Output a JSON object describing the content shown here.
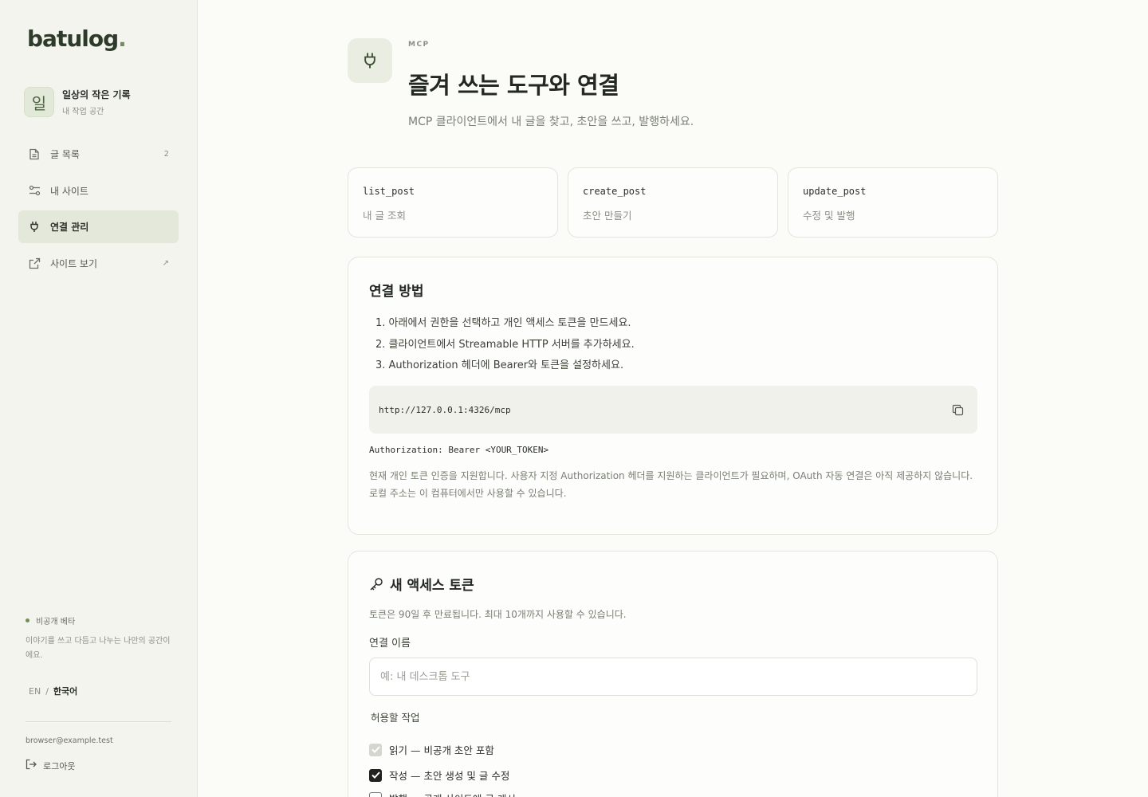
{
  "brand": {
    "name": "batulog",
    "dot": "."
  },
  "workspace": {
    "avatar": "일",
    "name": "일상의 작은 기록",
    "subtitle": "내 작업 공간"
  },
  "nav": [
    {
      "label": "글 목록",
      "icon": "document-icon",
      "trailing": "2"
    },
    {
      "label": "내 사이트",
      "icon": "sliders-icon",
      "trailing": ""
    },
    {
      "label": "연결 관리",
      "icon": "plug-icon",
      "trailing": "",
      "active": true
    },
    {
      "label": "사이트 보기",
      "icon": "external-link-icon",
      "trailing": "↗"
    }
  ],
  "beta": {
    "badge": "비공개 베타",
    "description": "이야기를 쓰고 다듬고 나누는 나만의 공간이에요."
  },
  "language": {
    "en": "EN",
    "separator": "/",
    "current": "한국어"
  },
  "account": {
    "email": "browser@example.test",
    "logout_label": "로그아웃"
  },
  "header": {
    "eyebrow": "MCP",
    "title": "즐겨 쓰는 도구와 연결",
    "subtitle": "MCP 클라이언트에서 내 글을 찾고, 초안을 쓰고, 발행하세요."
  },
  "tools": [
    {
      "name": "list_post",
      "description": "내 글 조회"
    },
    {
      "name": "create_post",
      "description": "초안 만들기"
    },
    {
      "name": "update_post",
      "description": "수정 및 발행"
    }
  ],
  "connect": {
    "title": "연결 방법",
    "steps": [
      "1. 아래에서 권한을 선택하고 개인 액세스 토큰을 만드세요.",
      "2. 클라이언트에서 Streamable HTTP 서버를 추가하세요.",
      "3. Authorization 헤더에 Bearer와 토큰을 설정하세요."
    ],
    "endpoint_url": "http://127.0.0.1:4326/mcp",
    "auth_header": "Authorization: Bearer <YOUR_TOKEN>",
    "note": "현재 개인 토큰 인증을 지원합니다. 사용자 지정 Authorization 헤더를 지원하는 클라이언트가 필요하며, OAuth 자동 연결은 아직 제공하지 않습니다. 로컬 주소는 이 컴퓨터에서만 사용할 수 있습니다."
  },
  "token": {
    "title": "새 액세스 토큰",
    "description": "토큰은 90일 후 만료됩니다. 최대 10개까지 사용할 수 있습니다.",
    "name_label": "연결 이름",
    "name_value": "",
    "name_placeholder": "예: 내 데스크톱 도구",
    "permissions_label": "허용할 작업",
    "permissions": [
      {
        "label": "읽기 — 비공개 초안 포함",
        "checked": true,
        "disabled": true
      },
      {
        "label": "작성 — 초안 생성 및 글 수정",
        "checked": true,
        "disabled": false
      },
      {
        "label": "발행 — 공개 사이트에 글 게시",
        "checked": false,
        "disabled": false
      }
    ]
  }
}
